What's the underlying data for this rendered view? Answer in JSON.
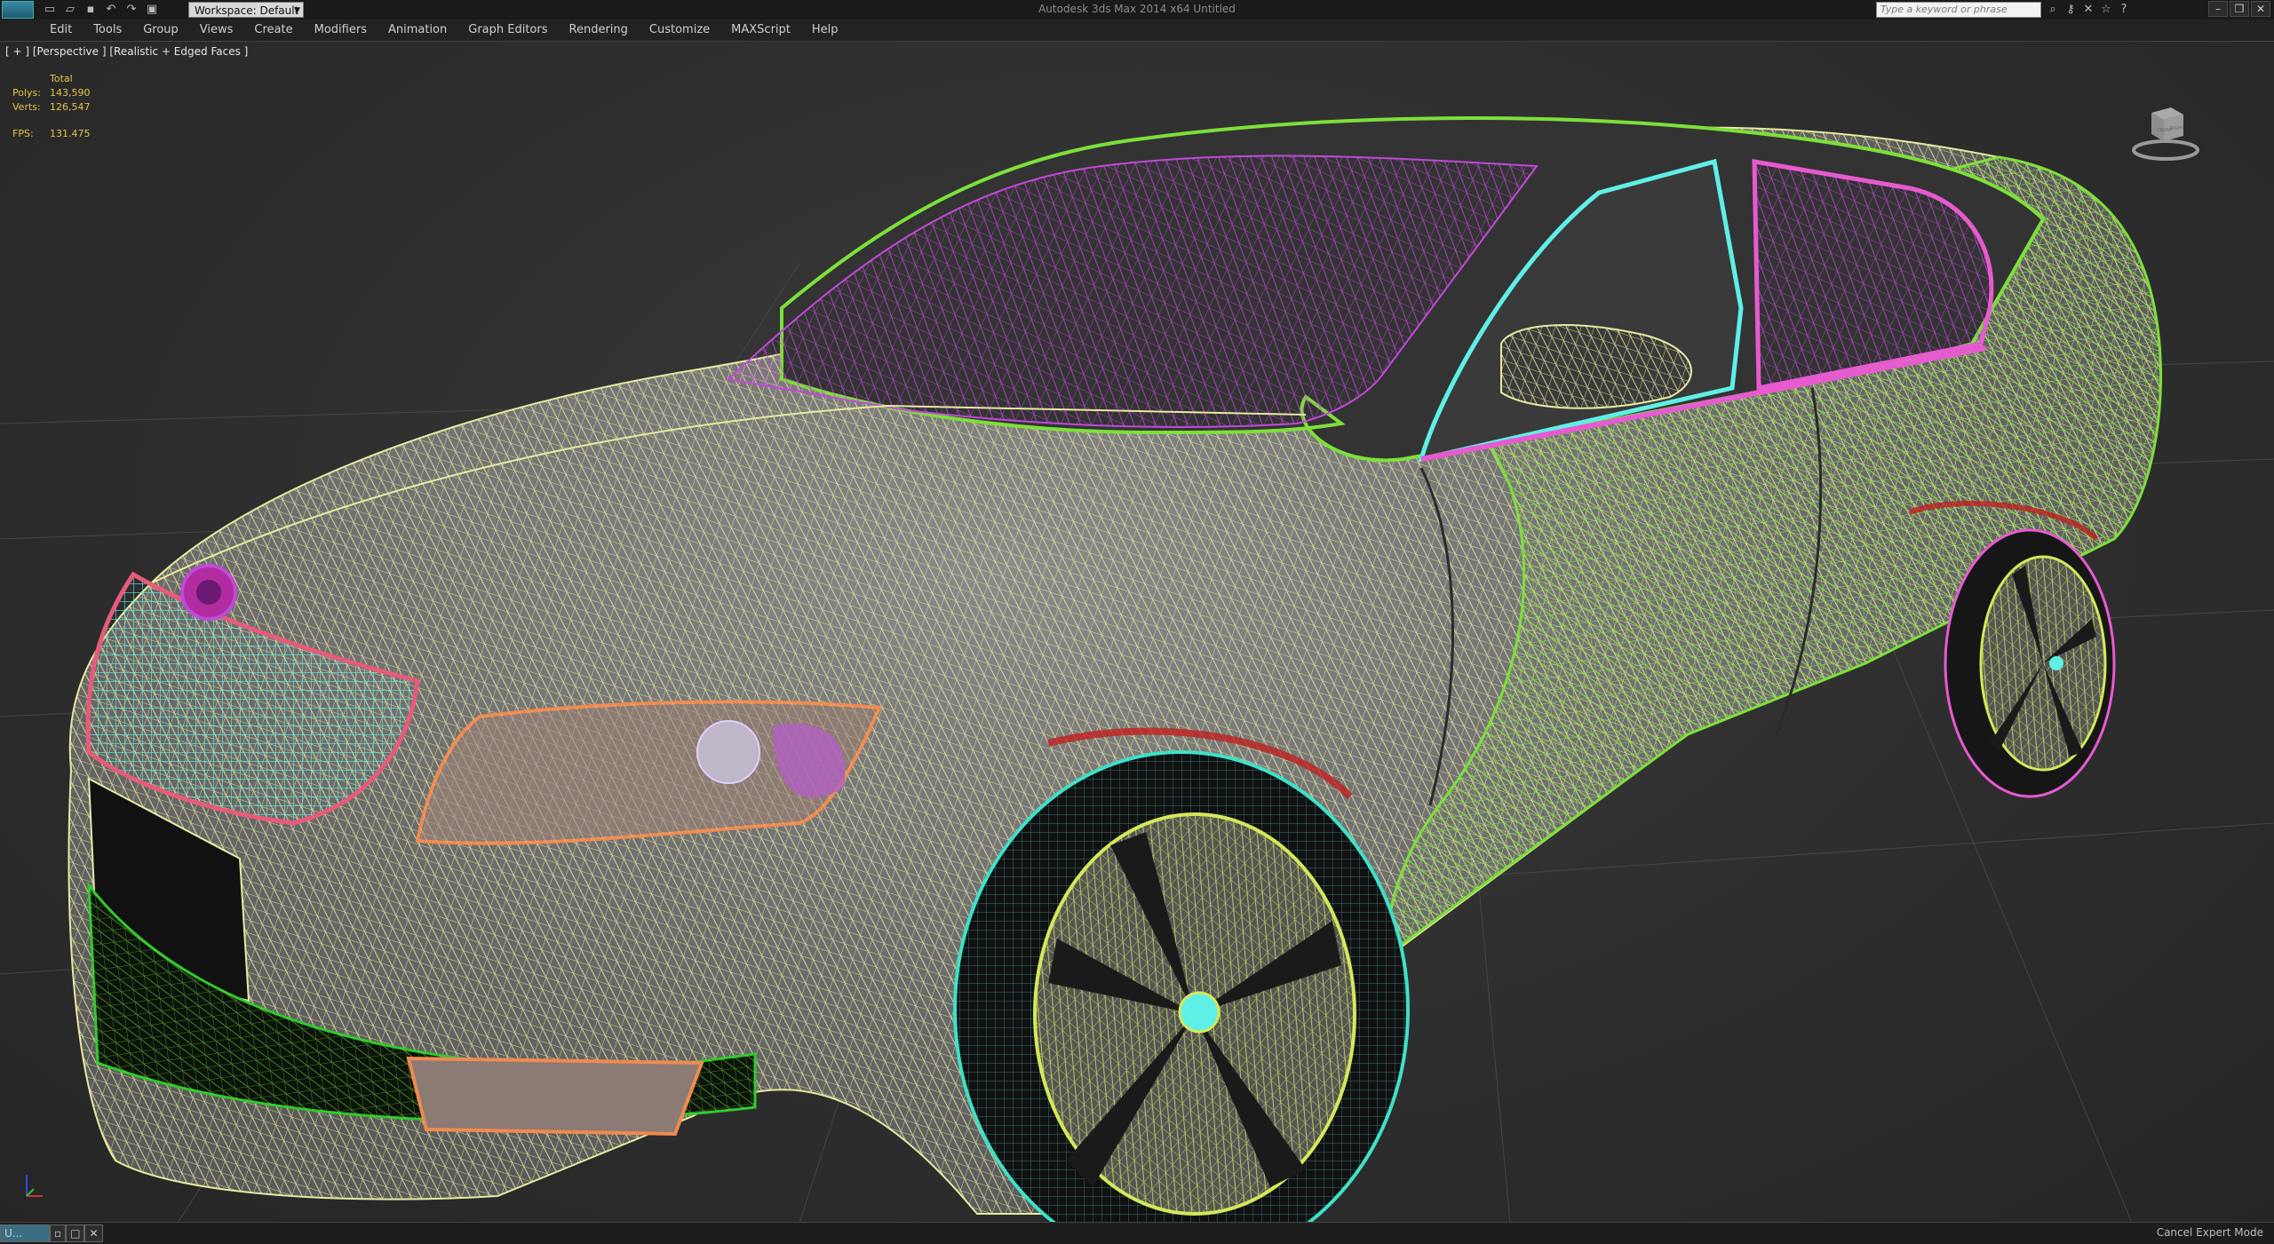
{
  "window": {
    "title": "Autodesk 3ds Max  2014 x64      Untitled",
    "workspace": "Workspace: Default",
    "search_placeholder": "Type a keyword or phrase"
  },
  "menu": [
    "Edit",
    "Tools",
    "Group",
    "Views",
    "Create",
    "Modifiers",
    "Animation",
    "Graph Editors",
    "Rendering",
    "Customize",
    "MAXScript",
    "Help"
  ],
  "viewport": {
    "label": "[ + ] [Perspective ] [Realistic + Edged Faces ]",
    "stats": {
      "total_label": "Total",
      "polys_label": "Polys:",
      "polys": "143,590",
      "verts_label": "Verts:",
      "verts": "126,547",
      "fps_label": "FPS:",
      "fps": "131.475"
    },
    "viewcube_faces": [
      "FRONT",
      "RIGHT"
    ]
  },
  "statusbar": {
    "task_label": "U...",
    "cancel_expert": "Cancel Expert Mode"
  },
  "icons": [
    "app-logo-icon",
    "new-icon",
    "open-icon",
    "save-icon",
    "undo-icon",
    "redo-icon",
    "project-icon",
    "binoculars-icon",
    "star-icon",
    "help-icon"
  ],
  "colors": {
    "wire_body": "#e8eaa0",
    "wire_glass": "#c04ad8",
    "wire_trim": "#5ef0e6",
    "wire_green": "#7de03a",
    "wire_chrome": "#e85a7a",
    "stats": "#e5c44a"
  }
}
